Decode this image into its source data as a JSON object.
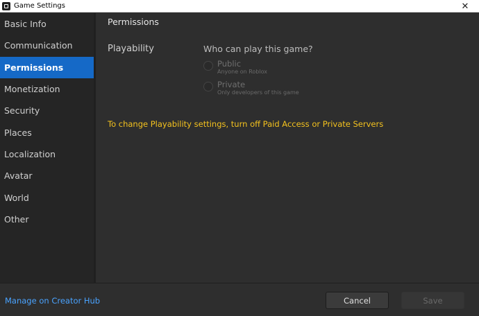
{
  "window": {
    "title": "Game Settings",
    "close_glyph": "✕",
    "icon": "roblox-studio-icon"
  },
  "sidebar": {
    "items": [
      {
        "label": "Basic Info",
        "active": false
      },
      {
        "label": "Communication",
        "active": false
      },
      {
        "label": "Permissions",
        "active": true
      },
      {
        "label": "Monetization",
        "active": false
      },
      {
        "label": "Security",
        "active": false
      },
      {
        "label": "Places",
        "active": false
      },
      {
        "label": "Localization",
        "active": false
      },
      {
        "label": "Avatar",
        "active": false
      },
      {
        "label": "World",
        "active": false
      },
      {
        "label": "Other",
        "active": false
      }
    ]
  },
  "main": {
    "section_title": "Permissions",
    "playability": {
      "label": "Playability",
      "question": "Who can play this game?",
      "options": [
        {
          "title": "Public",
          "subtitle": "Anyone on Roblox",
          "selected": false,
          "enabled": false
        },
        {
          "title": "Private",
          "subtitle": "Only developers of this game",
          "selected": false,
          "enabled": false
        }
      ]
    },
    "warning": "To change Playability settings, turn off Paid Access or Private Servers"
  },
  "footer": {
    "creator_hub_link": "Manage on Creator Hub",
    "cancel_label": "Cancel",
    "save_label": "Save"
  },
  "colors": {
    "accent": "#1569c7",
    "warning": "#f4c21e",
    "link": "#4aa3ff",
    "background": "#2e2e2e",
    "sidebar": "#252525"
  }
}
